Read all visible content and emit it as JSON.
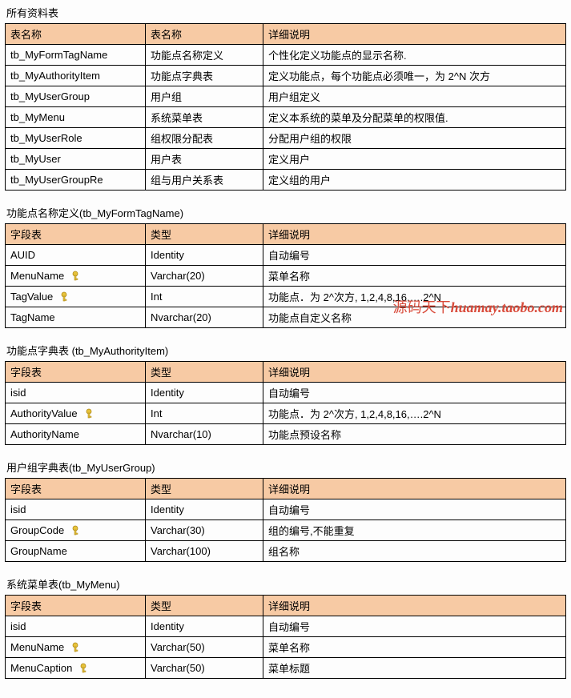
{
  "watermark": "源码天下huamay.taobo.com",
  "sections": [
    {
      "title": "所有资料表",
      "headers": [
        "表名称",
        "表名称",
        "详细说明"
      ],
      "rows": [
        {
          "c1": "tb_MyFormTagName",
          "c2": "功能点名称定义",
          "c3": "个性化定义功能点的显示名称.",
          "key": false
        },
        {
          "c1": "tb_MyAuthorityItem",
          "c2": "功能点字典表",
          "c3": "定义功能点，每个功能点必须唯一，为 2^N 次方",
          "key": false
        },
        {
          "c1": "tb_MyUserGroup",
          "c2": "用户组",
          "c3": "用户组定义",
          "key": false
        },
        {
          "c1": "tb_MyMenu",
          "c2": "系统菜单表",
          "c3": "定义本系统的菜单及分配菜单的权限值.",
          "key": false
        },
        {
          "c1": "tb_MyUserRole",
          "c2": "组权限分配表",
          "c3": "分配用户组的权限",
          "key": false
        },
        {
          "c1": "tb_MyUser",
          "c2": "用户表",
          "c3": "定义用户",
          "key": false
        },
        {
          "c1": "tb_MyUserGroupRe",
          "c2": "组与用户关系表",
          "c3": "定义组的用户",
          "key": false
        }
      ]
    },
    {
      "title": "功能点名称定义(tb_MyFormTagName)",
      "headers": [
        "字段表",
        "类型",
        "详细说明"
      ],
      "rows": [
        {
          "c1": "AUID",
          "c2": "Identity",
          "c3": "自动编号",
          "key": false
        },
        {
          "c1": "MenuName",
          "c2": "Varchar(20)",
          "c3": "菜单名称",
          "key": true
        },
        {
          "c1": "TagValue",
          "c2": "Int",
          "c3": "功能点．为 2^次方, 1,2,4,8,16,….2^N",
          "key": true
        },
        {
          "c1": "TagName",
          "c2": "Nvarchar(20)",
          "c3": "功能点自定义名称",
          "key": false
        }
      ]
    },
    {
      "title": "功能点字典表  (tb_MyAuthorityItem)",
      "headers": [
        "字段表",
        "类型",
        "详细说明"
      ],
      "rows": [
        {
          "c1": "isid",
          "c2": "Identity",
          "c3": "自动编号",
          "key": false
        },
        {
          "c1": "AuthorityValue",
          "c2": "Int",
          "c3": "功能点．为 2^次方, 1,2,4,8,16,….2^N",
          "key": true
        },
        {
          "c1": "AuthorityName",
          "c2": "Nvarchar(10)",
          "c3": "功能点预设名称",
          "key": false
        }
      ]
    },
    {
      "title": "用户组字典表(tb_MyUserGroup)",
      "headers": [
        "字段表",
        "类型",
        "详细说明"
      ],
      "rows": [
        {
          "c1": "isid",
          "c2": "Identity",
          "c3": "自动编号",
          "key": false
        },
        {
          "c1": "GroupCode",
          "c2": "Varchar(30)",
          "c3": "组的编号,不能重复",
          "key": true
        },
        {
          "c1": "GroupName",
          "c2": "Varchar(100)",
          "c3": "组名称",
          "key": false
        }
      ]
    },
    {
      "title": "系统菜单表(tb_MyMenu)",
      "headers": [
        "字段表",
        "类型",
        "详细说明"
      ],
      "rows": [
        {
          "c1": "isid",
          "c2": "Identity",
          "c3": "自动编号",
          "key": false
        },
        {
          "c1": "MenuName",
          "c2": "Varchar(50)",
          "c3": "菜单名称",
          "key": true
        },
        {
          "c1": "MenuCaption",
          "c2": "Varchar(50)",
          "c3": "菜单标题",
          "key": true
        }
      ]
    }
  ]
}
